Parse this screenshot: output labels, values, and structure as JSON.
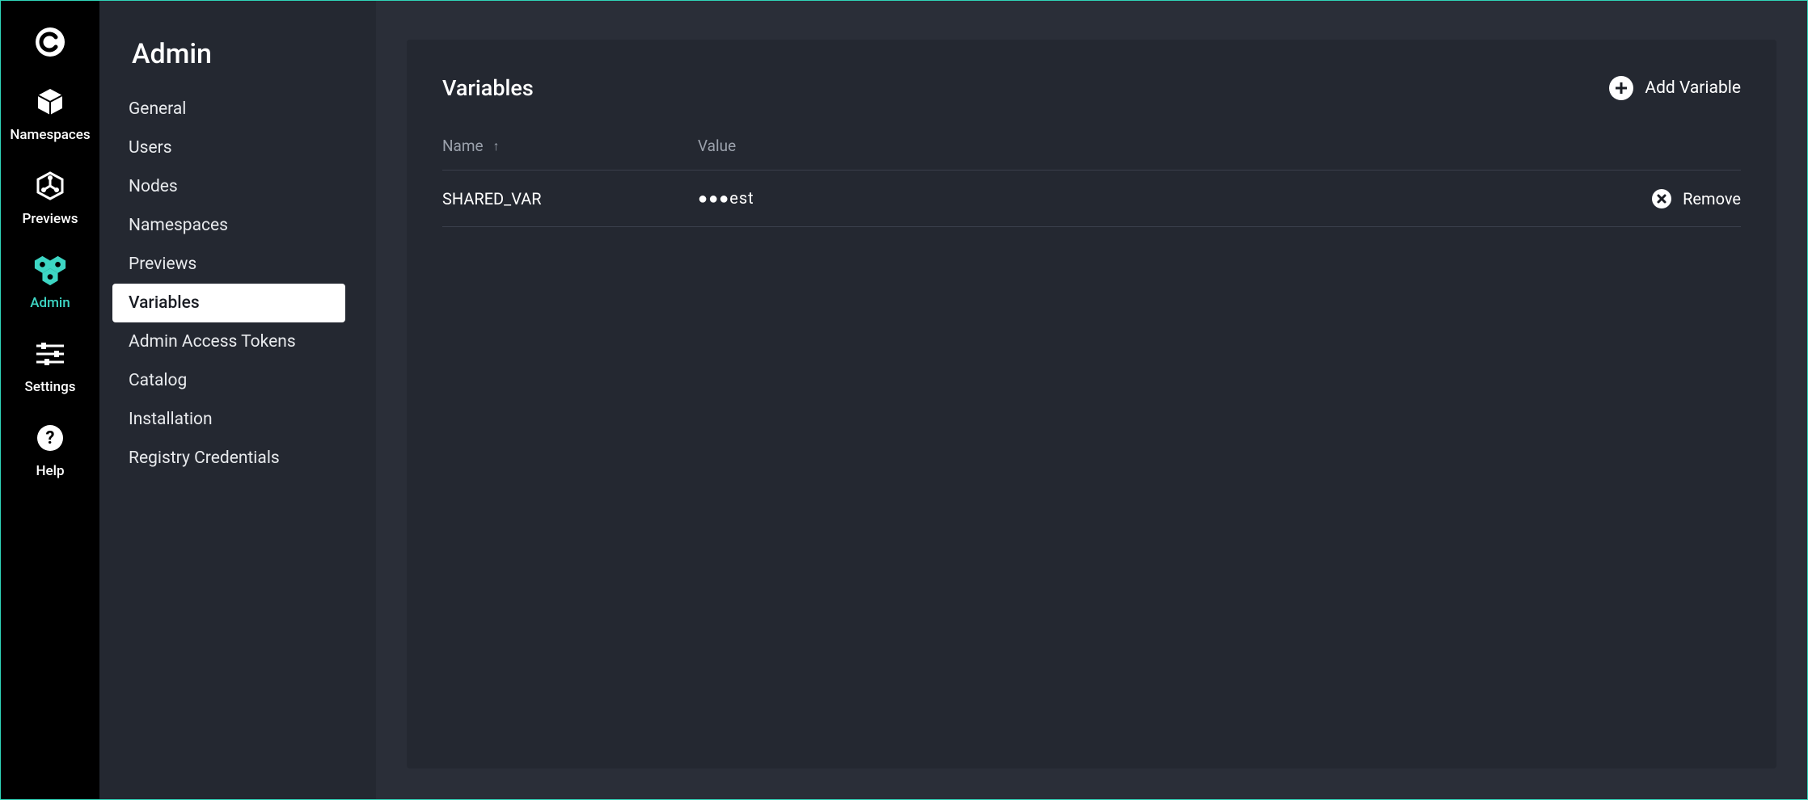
{
  "rail": {
    "items": [
      {
        "id": "namespaces",
        "label": "Namespaces"
      },
      {
        "id": "previews",
        "label": "Previews"
      },
      {
        "id": "admin",
        "label": "Admin",
        "active": true
      },
      {
        "id": "settings",
        "label": "Settings"
      },
      {
        "id": "help",
        "label": "Help"
      }
    ]
  },
  "sidebar": {
    "title": "Admin",
    "items": [
      {
        "label": "General"
      },
      {
        "label": "Users"
      },
      {
        "label": "Nodes"
      },
      {
        "label": "Namespaces"
      },
      {
        "label": "Previews"
      },
      {
        "label": "Variables",
        "active": true
      },
      {
        "label": "Admin Access Tokens"
      },
      {
        "label": "Catalog"
      },
      {
        "label": "Installation"
      },
      {
        "label": "Registry Credentials"
      }
    ]
  },
  "card": {
    "title": "Variables",
    "add_label": "Add Variable",
    "columns": {
      "name": "Name",
      "value": "Value"
    },
    "rows": [
      {
        "name": "SHARED_VAR",
        "value": "●●●est",
        "remove_label": "Remove"
      }
    ]
  }
}
